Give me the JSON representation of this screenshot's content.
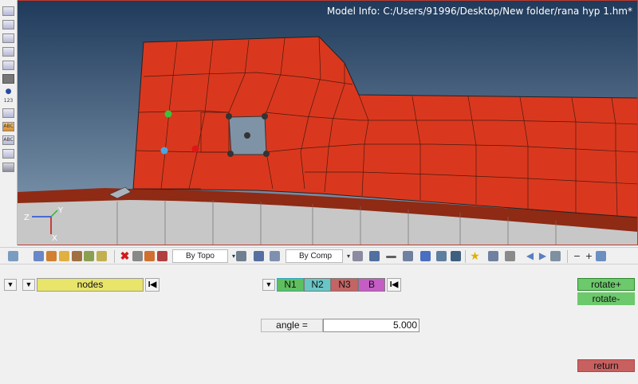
{
  "window": {
    "model_info": "Model Info: C:/Users/91996/Desktop/New folder/rana hyp 1.hm*"
  },
  "left_toolbar": {
    "icons": [
      "edges-icon",
      "faces-icon",
      "surface-icon",
      "solid-icon",
      "mesh-icon",
      "nodes-icon",
      "info-icon",
      "numbers-icon",
      "measure-icon",
      "plot-icon",
      "labels-icon",
      "card-icon",
      "mass-icon"
    ],
    "numbers_text": "123",
    "label_text": "ABC"
  },
  "viewport": {
    "background_top": "#1f3a5b",
    "background_bottom": "#7a93aa",
    "mesh_color": "#d9381e",
    "triad": {
      "x": "X",
      "y": "Y",
      "z": "Z"
    }
  },
  "toolbar": {
    "by_topo": "By Topo",
    "by_comp": "By Comp"
  },
  "panel": {
    "nodes_label": "nodes",
    "n1": "N1",
    "n2": "N2",
    "n3": "N3",
    "b": "B",
    "angle_label": "angle =",
    "angle_value": "5.000",
    "rotate_plus": "rotate+",
    "rotate_minus": "rotate-",
    "return_label": "return",
    "colors": {
      "nodes": "#e9e46a",
      "n1": "#5fbf5f",
      "n2": "#6ac6c6",
      "n3": "#c46464",
      "b": "#c55dc5",
      "rotate": "#6cc96c",
      "return": "#c86060"
    }
  }
}
